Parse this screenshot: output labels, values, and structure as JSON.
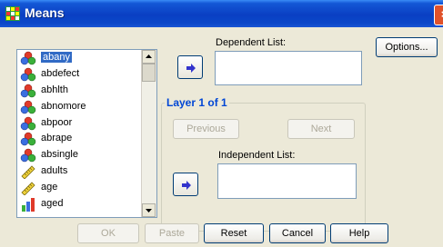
{
  "window": {
    "title": "Means",
    "close_glyph": "×"
  },
  "variables": [
    {
      "name": "abany",
      "icon": "nominal-icon",
      "selected": true
    },
    {
      "name": "abdefect",
      "icon": "nominal-icon"
    },
    {
      "name": "abhlth",
      "icon": "nominal-icon"
    },
    {
      "name": "abnomore",
      "icon": "nominal-icon"
    },
    {
      "name": "abpoor",
      "icon": "nominal-icon"
    },
    {
      "name": "abrape",
      "icon": "nominal-icon"
    },
    {
      "name": "absingle",
      "icon": "nominal-icon"
    },
    {
      "name": "adults",
      "icon": "scale-icon"
    },
    {
      "name": "age",
      "icon": "scale-icon"
    },
    {
      "name": "aged",
      "icon": "ordinal-icon"
    }
  ],
  "dependent_list": {
    "label": "Dependent List:"
  },
  "options_button": {
    "label": "Options..."
  },
  "layer": {
    "label": "Layer 1 of 1",
    "previous": "Previous",
    "next": "Next"
  },
  "independent_list": {
    "label": "Independent List:"
  },
  "buttons": {
    "ok": "OK",
    "paste": "Paste",
    "reset": "Reset",
    "cancel": "Cancel",
    "help": "Help"
  },
  "colors": {
    "accent": "#316ac5",
    "title_bar": "#0a3fc3",
    "group_label": "#0046d5"
  }
}
